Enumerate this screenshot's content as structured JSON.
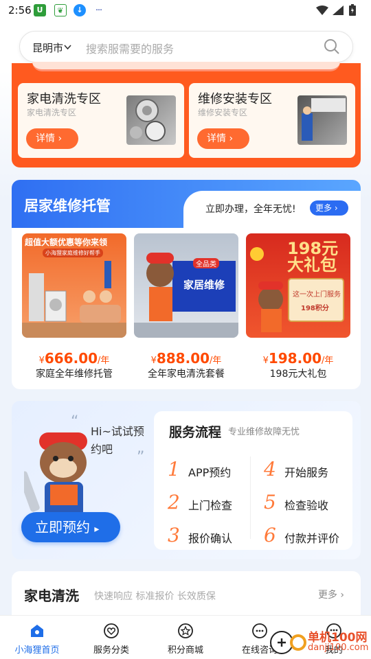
{
  "status_bar": {
    "time": "2:56",
    "app_icons": [
      "U",
      "❦",
      "↓",
      "···"
    ]
  },
  "search": {
    "city": "昆明市",
    "placeholder": "搜索服需要的服务"
  },
  "zones": [
    {
      "title": "家电清洗专区",
      "subtitle": "家电清洗专区",
      "button": "详情"
    },
    {
      "title": "维修安装专区",
      "subtitle": "维修安装专区",
      "button": "详情"
    }
  ],
  "hosting": {
    "title": "居家维修托管",
    "slogan": "立即办理，全年无忧!",
    "more": "更多",
    "packages": [
      {
        "banner": "超值大额优惠等你来领",
        "tag": "小海狸家庭维修好帮手",
        "price": "666.00",
        "currency": "¥",
        "unit": "/年",
        "name": "家庭全年维修托管"
      },
      {
        "banner": "全品类",
        "sign": "家居维修",
        "price": "888.00",
        "currency": "¥",
        "unit": "/年",
        "name": "全年家电清洗套餐"
      },
      {
        "banner": "198元\n大礼包",
        "scroll_title": "这一次上门服务",
        "scroll_sub": "198积分",
        "price": "198.00",
        "currency": "¥",
        "unit": "/年",
        "name": "198元大礼包"
      }
    ]
  },
  "process": {
    "hi_text": "Hi~试试预约吧",
    "book_button": "立即预约",
    "title": "服务流程",
    "subtitle": "专业维修故障无忧",
    "steps": [
      {
        "num": "1",
        "label": "APP预约"
      },
      {
        "num": "2",
        "label": "上门检查"
      },
      {
        "num": "3",
        "label": "报价确认"
      },
      {
        "num": "4",
        "label": "开始服务"
      },
      {
        "num": "5",
        "label": "检查验收"
      },
      {
        "num": "6",
        "label": "付款并评价"
      }
    ]
  },
  "cleaning": {
    "title": "家电清洗",
    "subtitle": "快速响应 标准报价 长效质保",
    "more": "更多"
  },
  "tabs": [
    {
      "label": "小海狸首页",
      "icon": "home-icon",
      "active": true
    },
    {
      "label": "服务分类",
      "icon": "heart-chat-icon",
      "active": false
    },
    {
      "label": "积分商城",
      "icon": "star-circle-icon",
      "active": false
    },
    {
      "label": "在线咨询",
      "icon": "chat-dots-icon",
      "active": false
    },
    {
      "label": "我的",
      "icon": "profile-chat-icon",
      "active": false
    }
  ],
  "watermark": {
    "line1": "单机100网",
    "line2": "danji100.com"
  },
  "colors": {
    "primary": "#1f6ee8",
    "orange": "#ff5a1f",
    "price": "#ff4a00"
  }
}
